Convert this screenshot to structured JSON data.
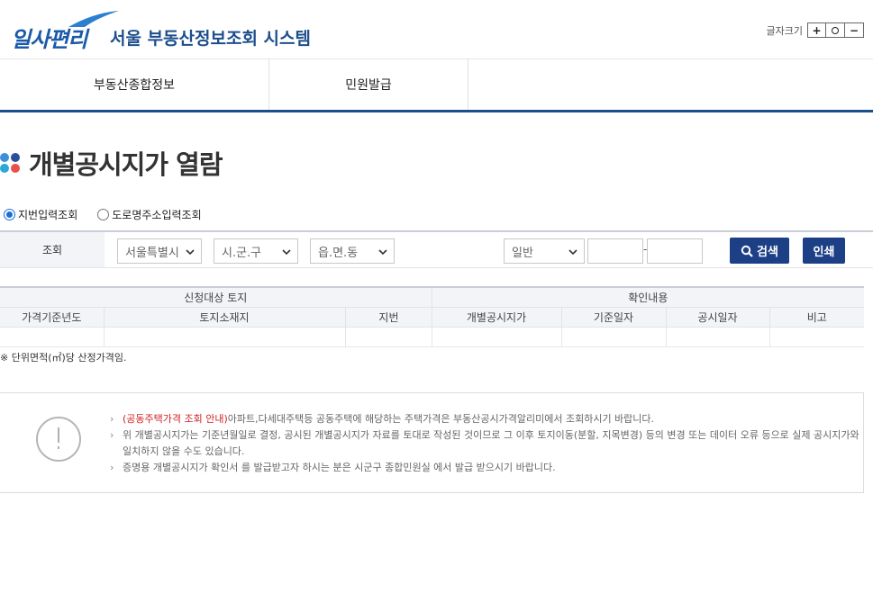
{
  "header": {
    "logo_main": "일사편리",
    "logo_sub": "서울 부동산정보조회 시스템",
    "fontsize_label": "글자크기",
    "fontsize_plus": "+",
    "fontsize_minus": "−"
  },
  "nav": {
    "items": [
      {
        "label": "부동산종합정보"
      },
      {
        "label": "민원발급"
      }
    ]
  },
  "page_title": "개별공시지가 열람",
  "search_mode": {
    "options": [
      {
        "label": "지번입력조회",
        "selected": true
      },
      {
        "label": "도로명주소입력조회",
        "selected": false
      }
    ]
  },
  "search": {
    "label": "조회",
    "city": "서울특별시",
    "district": "시.군.구",
    "dong": "읍.면.동",
    "lot_type": "일반",
    "main_number": "",
    "sub_number": "",
    "dash": "-",
    "search_button": "검색",
    "print_button": "인쇄"
  },
  "table": {
    "group_headers": [
      "신청대상 토지",
      "확인내용"
    ],
    "columns": [
      "가격기준년도",
      "토지소재지",
      "지번",
      "개별공시지가",
      "기준일자",
      "공시일자",
      "비고"
    ]
  },
  "note": "※ 단위면적(㎡)당 산정가격임.",
  "info": {
    "bullet": "›",
    "item1_link": "(공동주택가격 조회 안내)",
    "item1_text": "아파트,다세대주택등 공동주택에 해당하는 주택가격은 부동산공시가격알리미에서 조회하시기 바랍니다.",
    "item2_text": "위 개별공시지가는 기준년월일로 결정, 공시된 개별공시지가 자료를 토대로 작성된 것이므로 그 이후 토지이동(분할, 지목변경) 등의 변경 또는 데이터 오류 등으로 실제 공시지가와 일치하지 않을 수도 있습니다.",
    "item3_text": "증명용 개별공시지가 확인서 를 발급받고자 하시는 분은 시군구 종합민원실 에서 발급 받으시기 바랍니다."
  },
  "colors": {
    "brand": "#1c4e8c",
    "button": "#1c3f86",
    "link_red": "#d11f1f"
  }
}
